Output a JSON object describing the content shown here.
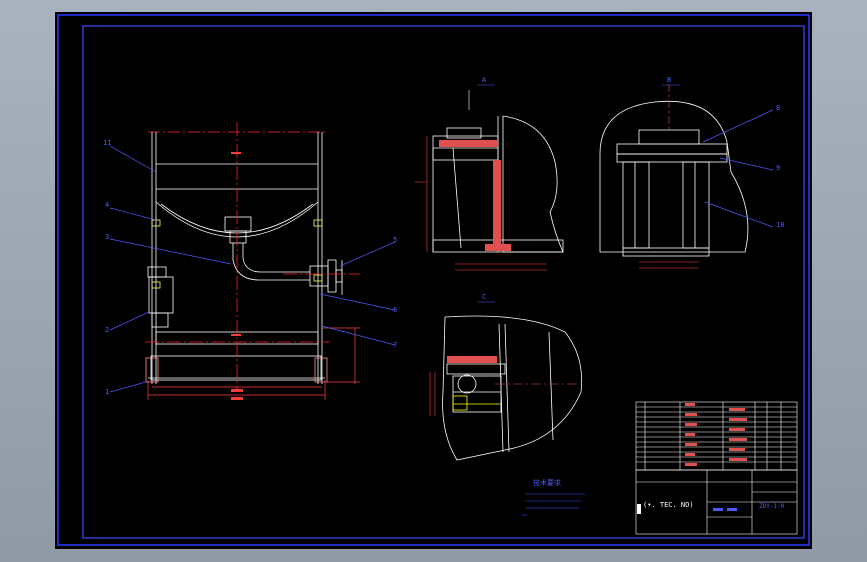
{
  "colors": {
    "background": "#000000",
    "frame": "#2a3cff",
    "outline": "#ffffff",
    "centerline": "#ff2020",
    "dimension": "#ff3c3c",
    "section": "#ff2020",
    "note": "#3050ff",
    "hatch": "#e05050",
    "leader": "#4a5cff",
    "weld": "#ffff00",
    "title_lines": "#ffffff"
  },
  "main_view": {
    "part_numbers": [
      "11",
      "4",
      "3",
      "2",
      "1",
      "5",
      "6",
      "7"
    ]
  },
  "section_views": {
    "labels": [
      "A",
      "B",
      "C"
    ],
    "part_numbers_right": [
      "8",
      "9",
      "10"
    ]
  },
  "notes": {
    "title": "技术要求"
  },
  "title_block": {
    "main_text": "(•. TEC. NO)",
    "drawing_no": "ZDY-1-0"
  }
}
